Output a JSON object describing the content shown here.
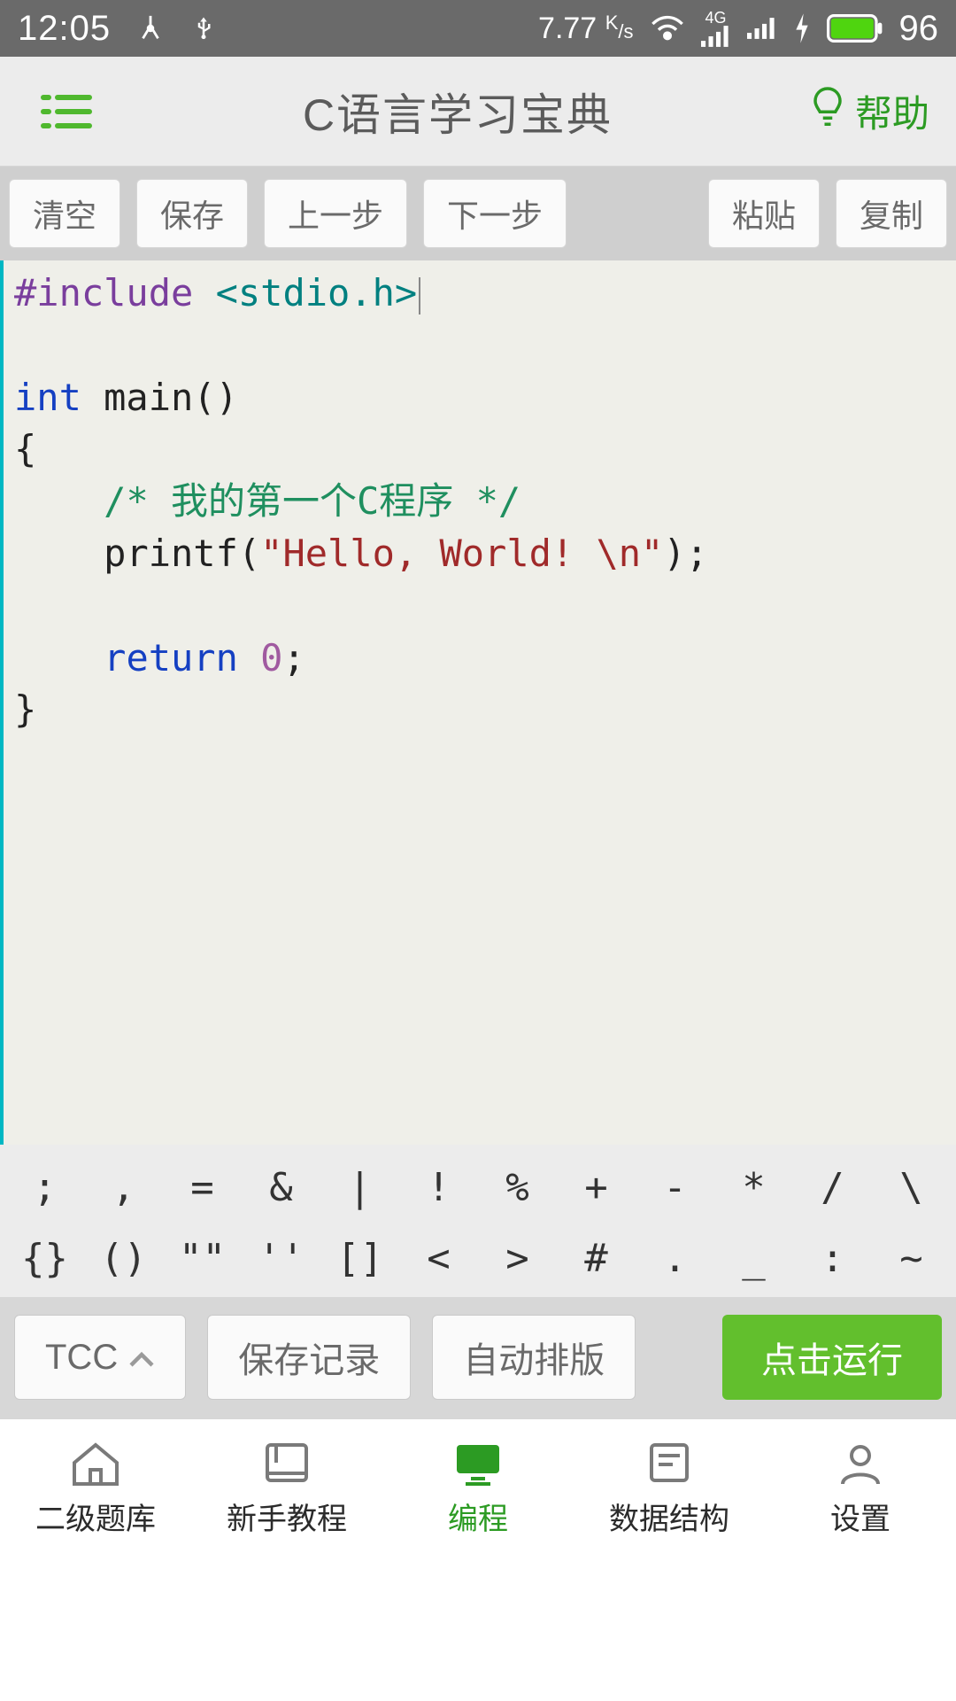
{
  "status": {
    "time": "12:05",
    "speed_value": "7.77",
    "speed_unit_top": "K",
    "speed_unit_bottom": "/s",
    "network_gen": "4G",
    "battery_pct": "96"
  },
  "header": {
    "title": "C语言学习宝典",
    "help_label": "帮助"
  },
  "toolbar": {
    "clear": "清空",
    "save": "保存",
    "undo": "上一步",
    "redo": "下一步",
    "paste": "粘贴",
    "copy": "复制"
  },
  "code": {
    "line1_pp": "#include",
    "line1_inc": "<stdio.h>",
    "line3_kw": "int",
    "line3_rest": " main()",
    "line4": "{",
    "line5_indent": "    ",
    "line5_cmt": "/* 我的第一个C程序 */",
    "line6_indent": "    ",
    "line6_a": "printf(",
    "line6_str": "\"Hello, World! \\n\"",
    "line6_b": ");",
    "line8_indent": "    ",
    "line8_kw": "return",
    "line8_sp": " ",
    "line8_num": "0",
    "line8_b": ";",
    "line9": "}"
  },
  "symboard": {
    "row1": [
      ";",
      ",",
      "=",
      "&",
      "|",
      "!",
      "%",
      "+",
      "-",
      "*",
      "/",
      "\\"
    ],
    "row2": [
      "{}",
      "()",
      "\"\"",
      "''",
      "[]",
      "<",
      ">",
      "#",
      ".",
      "_",
      ":",
      "~"
    ]
  },
  "actions": {
    "compiler": "TCC",
    "history": "保存记录",
    "format": "自动排版",
    "run": "点击运行"
  },
  "tabs": {
    "t1": "二级题库",
    "t2": "新手教程",
    "t3": "编程",
    "t4": "数据结构",
    "t5": "设置"
  }
}
